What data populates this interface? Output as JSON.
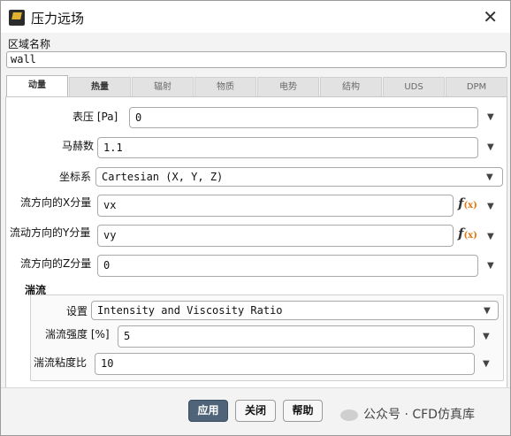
{
  "window": {
    "title": "压力远场",
    "close_label": "✕"
  },
  "zone": {
    "label": "区域名称",
    "value": "wall"
  },
  "tabs": [
    {
      "label": "动量"
    },
    {
      "label": "热量"
    },
    {
      "label": "辐射"
    },
    {
      "label": "物质"
    },
    {
      "label": "电势"
    },
    {
      "label": "结构"
    },
    {
      "label": "UDS"
    },
    {
      "label": "DPM"
    }
  ],
  "fields": {
    "gauge_pressure": {
      "label": "表压 [Pa]",
      "value": "0"
    },
    "mach": {
      "label": "马赫数",
      "value": "1.1"
    },
    "coord_system": {
      "label": "坐标系",
      "value": "Cartesian (X, Y, Z)"
    },
    "x_dir": {
      "label": "流方向的X分量",
      "value": "vx"
    },
    "y_dir": {
      "label": "流动方向的Y分量",
      "value": "vy"
    },
    "z_dir": {
      "label": "流方向的Z分量",
      "value": "0"
    }
  },
  "turbulence": {
    "title": "湍流",
    "method": {
      "label": "设置",
      "value": "Intensity and Viscosity Ratio"
    },
    "intensity": {
      "label": "湍流强度 [%]",
      "value": "5"
    },
    "viscosity_ratio": {
      "label": "湍流粘度比",
      "value": "10"
    }
  },
  "buttons": {
    "apply": "应用",
    "close": "关闭",
    "help": "帮助"
  },
  "watermark": "公众号 · CFD仿真库",
  "icons": {
    "dropdown": "chevron-down-icon",
    "fx": "function-icon",
    "app": "fluent-app-icon"
  }
}
